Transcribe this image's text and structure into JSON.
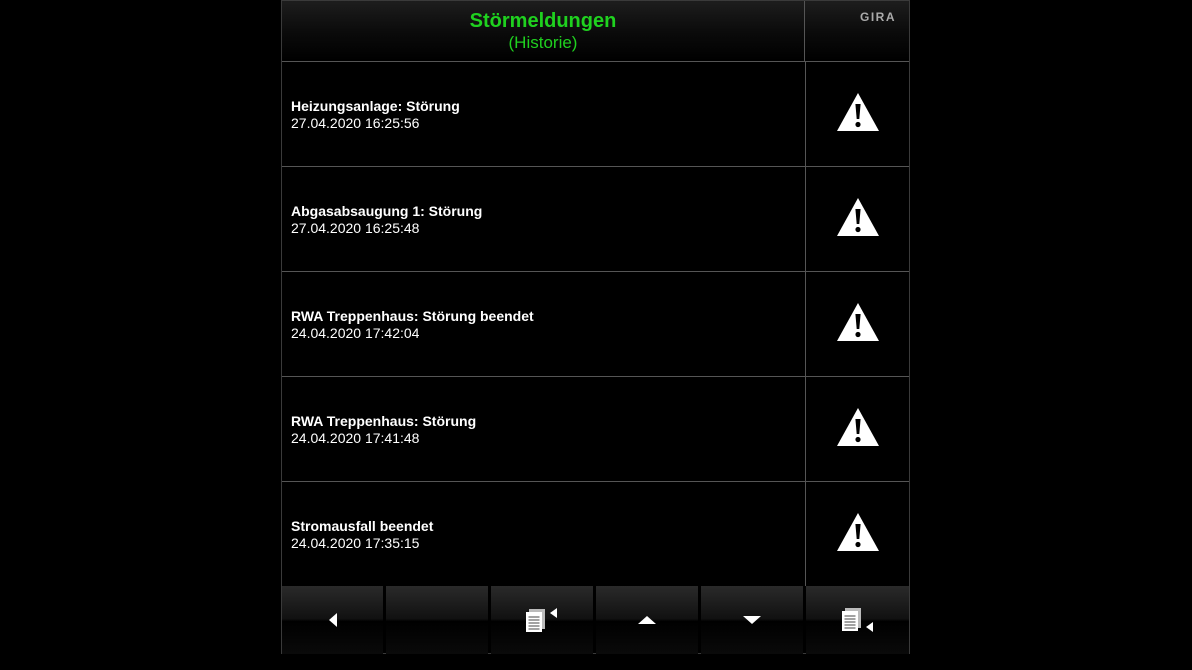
{
  "header": {
    "title": "Störmeldungen",
    "subtitle": "(Historie)",
    "brand": "GIRA"
  },
  "messages": [
    {
      "text": "Heizungsanlage: Störung",
      "timestamp": "27.04.2020  16:25:56",
      "icon": "warning-icon"
    },
    {
      "text": "Abgasabsaugung 1: Störung",
      "timestamp": "27.04.2020  16:25:48",
      "icon": "warning-icon"
    },
    {
      "text": "RWA Treppenhaus: Störung beendet",
      "timestamp": "24.04.2020  17:42:04",
      "icon": "warning-icon"
    },
    {
      "text": "RWA Treppenhaus: Störung",
      "timestamp": "24.04.2020  17:41:48",
      "icon": "warning-icon"
    },
    {
      "text": "Stromausfall beendet",
      "timestamp": "24.04.2020  17:35:15",
      "icon": "warning-icon"
    }
  ],
  "toolbar": [
    {
      "name": "back-button",
      "icon": "arrow-left-icon"
    },
    {
      "name": "blank-button",
      "icon": ""
    },
    {
      "name": "document-prev-button",
      "icon": "document-arrow-left-icon"
    },
    {
      "name": "scroll-up-button",
      "icon": "arrow-up-icon"
    },
    {
      "name": "scroll-down-button",
      "icon": "arrow-down-icon"
    },
    {
      "name": "document-next-button",
      "icon": "document-arrow-right-icon"
    }
  ],
  "colors": {
    "title": "#1fd11f",
    "background": "#000000",
    "text": "#ffffff",
    "divider": "#555555"
  }
}
